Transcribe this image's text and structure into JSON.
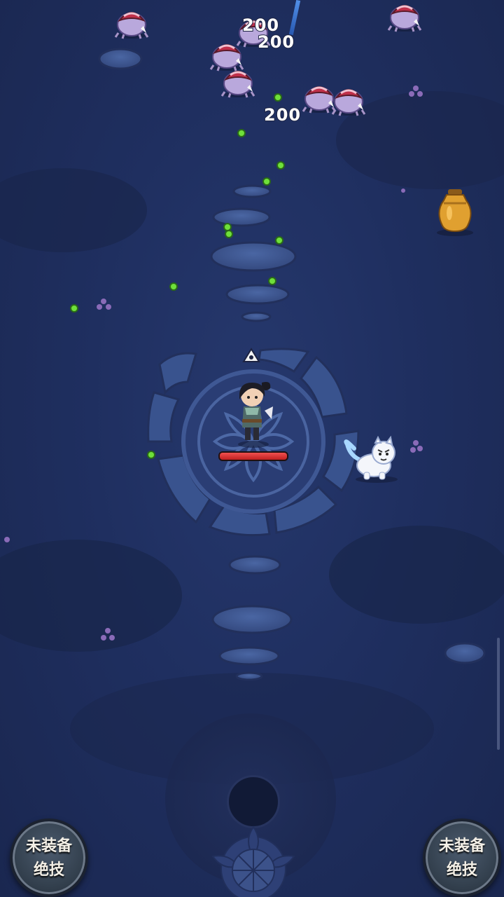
{
  "damage_numbers": [
    "200",
    "200",
    "200"
  ],
  "skill_buttons": {
    "left": {
      "line1": "未装备",
      "line2": "绝技"
    },
    "right": {
      "line1": "未装备",
      "line2": "绝技"
    }
  },
  "player": {
    "hp_fraction": 1.0
  },
  "colors": {
    "ground": "#1f2f60",
    "exp_orb": "#6fe03a",
    "hp": "#e03a3a"
  },
  "icons": [
    "direction-marker-icon",
    "joystick-knob-icon",
    "lotus-emblem-icon"
  ]
}
